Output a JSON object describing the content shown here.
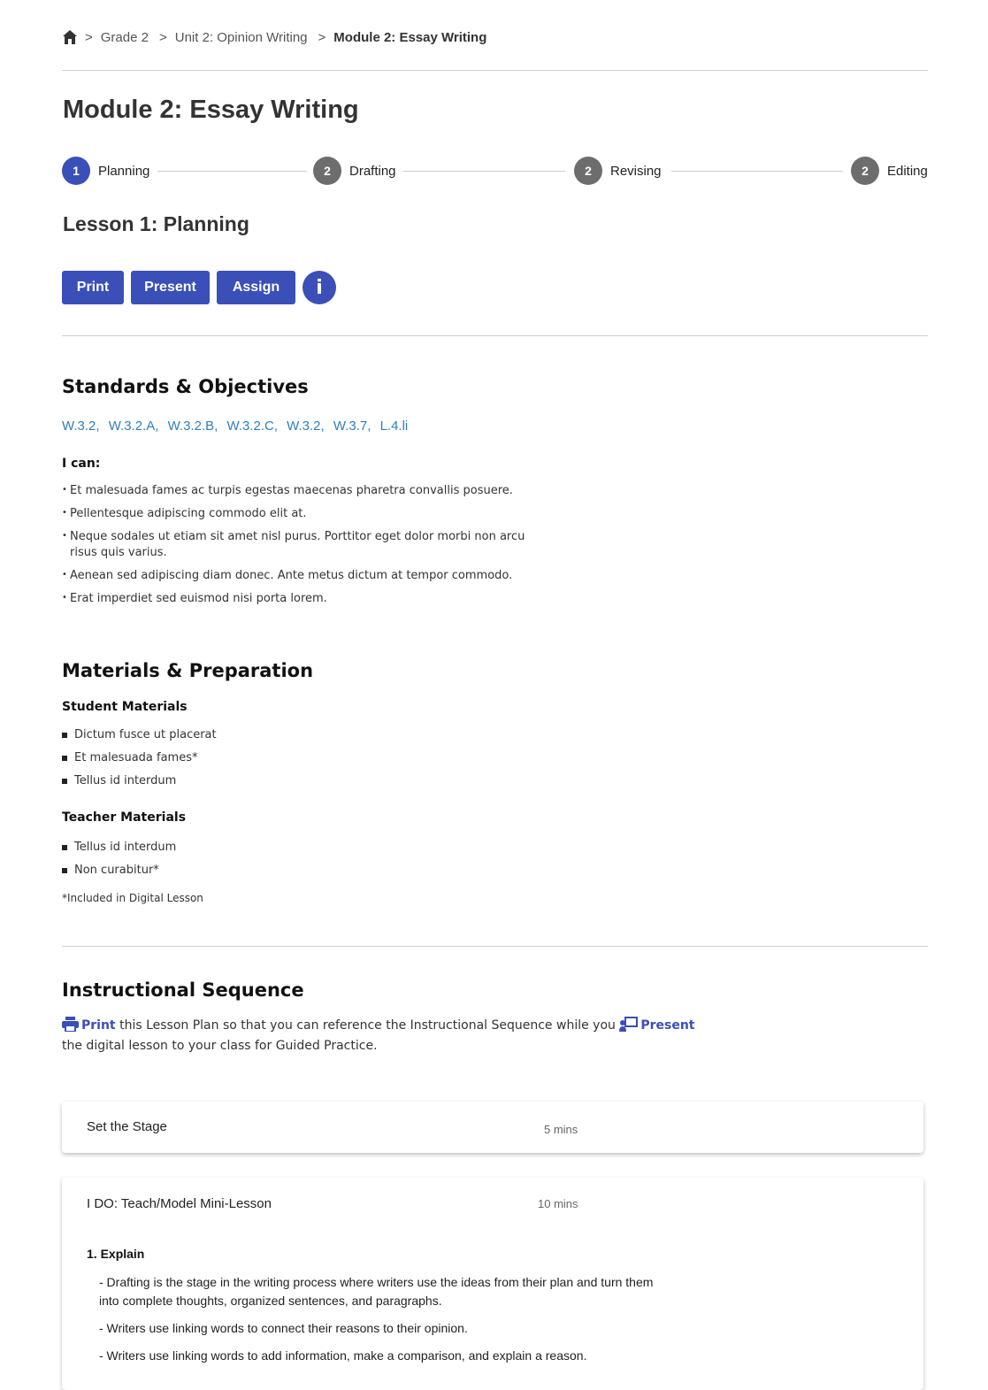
{
  "breadcrumb": {
    "items": [
      "Grade 2",
      "Unit 2: Opinion Writing"
    ],
    "current": "Module 2: Essay Writing",
    "separator": ">"
  },
  "page_title": "Module 2: Essay Writing",
  "stepper": {
    "steps": [
      {
        "number": "1",
        "label": "Planning",
        "active": true
      },
      {
        "number": "2",
        "label": "Drafting",
        "active": false
      },
      {
        "number": "2",
        "label": "Revising",
        "active": false
      },
      {
        "number": "2",
        "label": "Editing",
        "active": false
      }
    ]
  },
  "lesson_title": "Lesson 1: Planning",
  "actions": {
    "print": "Print",
    "present": "Present",
    "assign": "Assign",
    "info": "i"
  },
  "standards_section": {
    "heading": "Standards & Objectives",
    "standards": [
      "W.3.2",
      "W.3.2.A",
      "W.3.2.B",
      "W.3.2.C",
      "W.3.2",
      "W.3.7",
      "L.4.li"
    ],
    "ican_label": "I can:",
    "objectives": [
      "Et malesuada fames ac turpis egestas maecenas pharetra convallis posuere.",
      "Pellentesque adipiscing commodo elit at.",
      "Neque sodales ut etiam sit amet nisl purus. Porttitor eget dolor morbi non arcu risus quis varius.",
      "Aenean sed adipiscing diam donec. Ante metus dictum at tempor commodo.",
      "Erat imperdiet sed euismod nisi porta lorem."
    ]
  },
  "materials_section": {
    "heading": "Materials & Preparation",
    "student_heading": "Student Materials",
    "student_items": [
      "Dictum fusce ut placerat",
      "Et malesuada fames*",
      "Tellus id interdum"
    ],
    "teacher_heading": "Teacher Materials",
    "teacher_items": [
      "Tellus id interdum",
      "Non curabitur*"
    ],
    "footnote": "*Included in Digital Lesson"
  },
  "sequence_section": {
    "heading": "Instructional Sequence",
    "print_link": "Print",
    "text_part1": " this Lesson Plan so that you can reference the Instructional Sequence while you ",
    "present_link": "Present",
    "text_part2": " the digital lesson to your class for Guided Practice."
  },
  "cards": [
    {
      "title": "Set the Stage",
      "time": "5 mins"
    },
    {
      "title": "I DO: Teach/Model Mini-Lesson",
      "time": "10 mins",
      "section_title": "1. Explain",
      "bullets": [
        "- Drafting is the stage in the writing process where writers use the ideas from their plan and turn them into complete thoughts, organized sentences, and paragraphs.",
        "- Writers use linking words to connect their reasons to their opinion.",
        "- Writers use linking words to add information, make a comparison, and explain a reason."
      ]
    }
  ],
  "colors": {
    "accent": "#3a4fb8",
    "link": "#2d7fc0",
    "inactive_step": "#6d6d6d"
  }
}
